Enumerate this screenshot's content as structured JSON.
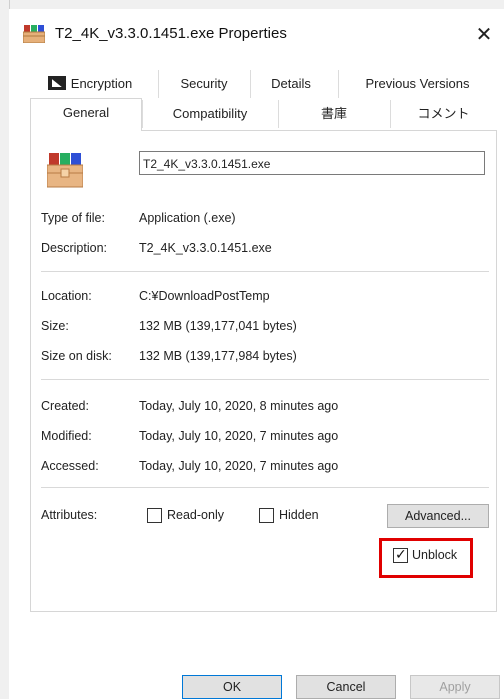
{
  "window": {
    "title": "T2_4K_v3.3.0.1451.exe Properties",
    "close_label": "✕"
  },
  "tabs": {
    "row1": [
      {
        "label": "Encryption",
        "icon": "encryption-icon"
      },
      {
        "label": "Security"
      },
      {
        "label": "Details"
      },
      {
        "label": "Previous Versions"
      }
    ],
    "row2": [
      {
        "label": "General",
        "active": true
      },
      {
        "label": "Compatibility"
      },
      {
        "label": "書庫"
      },
      {
        "label": "コメント"
      }
    ]
  },
  "general": {
    "file_name": "T2_4K_v3.3.0.1451.exe",
    "type_label": "Type of file:",
    "type_value": "Application (.exe)",
    "description_label": "Description:",
    "description_value": "T2_4K_v3.3.0.1451.exe",
    "location_label": "Location:",
    "location_value": "C:¥DownloadPostTemp",
    "size_label": "Size:",
    "size_value": "132 MB (139,177,041 bytes)",
    "size_on_disk_label": "Size on disk:",
    "size_on_disk_value": "132 MB (139,177,984 bytes)",
    "created_label": "Created:",
    "created_value": "Today, July 10, 2020, 8 minutes ago",
    "modified_label": "Modified:",
    "modified_value": "Today, July 10, 2020, 7 minutes ago",
    "accessed_label": "Accessed:",
    "accessed_value": "Today, July 10, 2020, 7 minutes ago",
    "attributes_label": "Attributes:",
    "read_only_label": "Read-only",
    "hidden_label": "Hidden",
    "advanced_label": "Advanced...",
    "unblock_label": "Unblock",
    "unblock_checked": true
  },
  "footer": {
    "ok_label": "OK",
    "cancel_label": "Cancel",
    "apply_label": "Apply"
  },
  "colors": {
    "highlight": "#e00000",
    "ok_border": "#0078d7"
  }
}
